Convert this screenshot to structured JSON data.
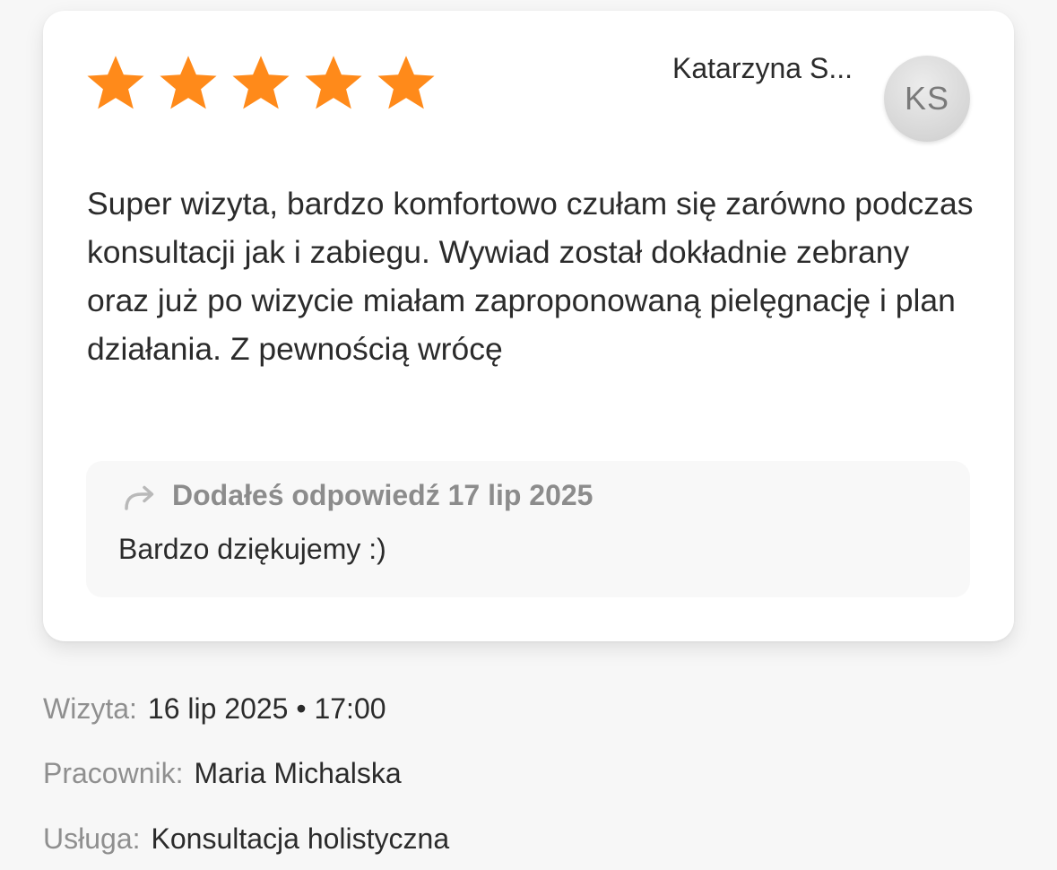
{
  "review": {
    "rating": 5,
    "max_rating": 5,
    "star_color": "#ff8a1a",
    "author_name": "Katarzyna S...",
    "author_initials": "KS",
    "text": "Super wizyta, bardzo komfortowo czułam się zarówno podczas konsultacji jak i zabiegu. Wywiad został dokładnie zebrany oraz już po wizycie miałam zaproponowaną pielęgnację i plan działania. Z pewnością wrócę"
  },
  "reply": {
    "icon": "reply-arrow-icon",
    "meta": "Dodałeś odpowiedź 17 lip 2025",
    "text": "Bardzo dziękujemy :)"
  },
  "details": {
    "visit_label": "Wizyta:",
    "visit_value": "16 lip 2025 • 17:00",
    "employee_label": "Pracownik:",
    "employee_value": "Maria Michalska",
    "service_label": "Usługa:",
    "service_value": "Konsultacja holistyczna"
  }
}
